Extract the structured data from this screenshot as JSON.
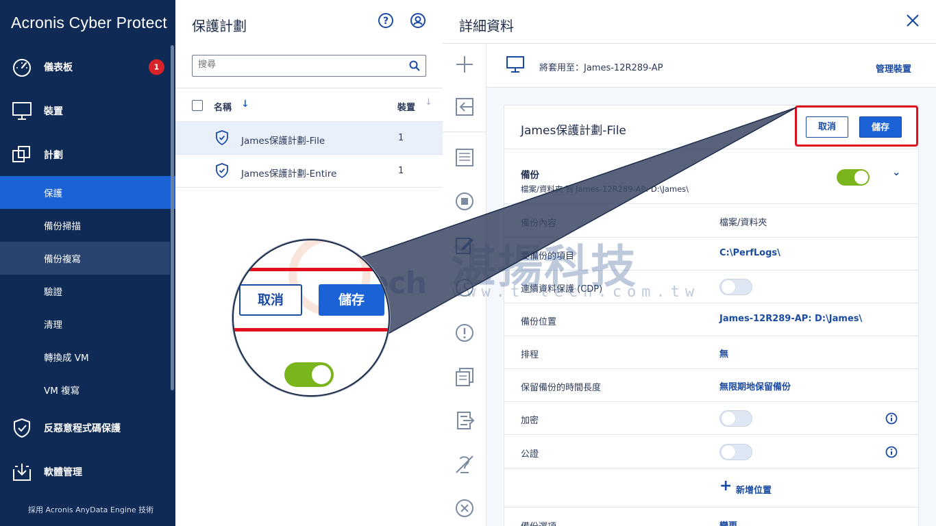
{
  "brand": "Acronis Cyber Protect",
  "sidebar": {
    "top_items": [
      {
        "label": "儀表板",
        "icon": "dashboard-icon",
        "badge": "1"
      },
      {
        "label": "裝置",
        "icon": "monitor-icon"
      },
      {
        "label": "計劃",
        "icon": "plans-icon"
      }
    ],
    "sub_items": [
      {
        "label": "保護",
        "active": true
      },
      {
        "label": "備份掃描"
      },
      {
        "label": "備份複寫"
      },
      {
        "label": "驗證"
      },
      {
        "label": "清理"
      },
      {
        "label": "轉換成 VM"
      },
      {
        "label": "VM 複寫"
      }
    ],
    "bottom_items": [
      {
        "label": "反惡意程式碼保護",
        "icon": "shield-check-icon"
      },
      {
        "label": "軟體管理",
        "icon": "software-download-icon"
      }
    ],
    "footer": "採用 Acronis AnyData Engine 技術"
  },
  "list": {
    "title": "保護計劃",
    "search_placeholder": "搜尋",
    "col_name": "名稱",
    "col_devices": "裝置",
    "rows": [
      {
        "name": "James保護計劃-File",
        "count": "1"
      },
      {
        "name": "James保護計劃-Entire",
        "count": "1"
      }
    ]
  },
  "detail": {
    "title": "詳細資料",
    "applied_to": "將套用至：James-12R289-AP",
    "manage": "管理裝置",
    "plan_name": "James保護計劃-File",
    "cancel": "取消",
    "save": "儲存",
    "backup_title": "備份",
    "backup_sub": "檔案/資料夾 到 James-12R289-AP: D:\\James\\",
    "rows": [
      {
        "key": "備份內容",
        "value": "檔案/資料夾"
      },
      {
        "key": "要備份的項目",
        "value": "C:\\PerfLogs\\"
      },
      {
        "key": "連續資料保護 (CDP)",
        "toggle": "off"
      },
      {
        "key": "備份位置",
        "value": "James-12R289-AP: D:\\James\\"
      },
      {
        "key": "排程",
        "value": "無"
      },
      {
        "key": "保留備份的時間長度",
        "value": "無限期地保留備份"
      },
      {
        "key": "加密",
        "toggle": "off"
      },
      {
        "key": "公證",
        "toggle": "off"
      }
    ],
    "add_location": "新增位置",
    "options_key": "備份選項",
    "options_value": "變更"
  },
  "watermark": {
    "logo": "T-tech",
    "name": "湛揚科技",
    "url": "www.t-tech.com.tw"
  },
  "magnifier": {
    "cancel": "取消",
    "save": "儲存"
  },
  "colors": {
    "sidebar": "#0e2a55",
    "accent": "#1a62d6",
    "highlight": "#e0101d",
    "toggle_on": "#7ab51d"
  }
}
